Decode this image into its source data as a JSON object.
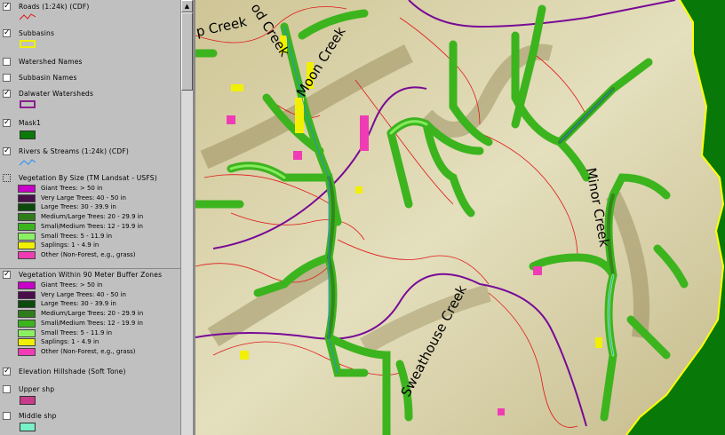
{
  "legend": {
    "layers": [
      {
        "label": "Roads (1:24k) (CDF)",
        "checked": true
      },
      {
        "label": "Subbasins",
        "checked": true
      },
      {
        "label": "Watershed Names",
        "checked": false
      },
      {
        "label": "Subbasin Names",
        "checked": false
      },
      {
        "label": "Dalwater Watersheds",
        "checked": true
      },
      {
        "label": "Mask1",
        "checked": true
      },
      {
        "label": "Rivers & Streams (1:24k) (CDF)",
        "checked": true
      },
      {
        "label": "Vegetation By Size (TM Landsat - USFS)",
        "checked": false
      },
      {
        "label": "Vegetation Within 90 Meter Buffer Zones",
        "checked": true
      },
      {
        "label": "Elevation Hillshade (Soft Tone)",
        "checked": true
      },
      {
        "label": "Upper shp",
        "checked": false
      },
      {
        "label": "Middle shp",
        "checked": false
      }
    ],
    "veg_classes": [
      {
        "label": "Giant Trees: > 50 in",
        "color": "#c800c8"
      },
      {
        "label": "Very Large Trees: 40 - 50 in",
        "color": "#4a0f4a"
      },
      {
        "label": "Large Trees: 30 - 39.9 in",
        "color": "#0b4a0b"
      },
      {
        "label": "Medium/Large Trees: 20 - 29.9 in",
        "color": "#2f7d1a"
      },
      {
        "label": "Small/Medium Trees: 12 - 19.9 in",
        "color": "#3cb41e"
      },
      {
        "label": "Small Trees: 5 - 11.9 in",
        "color": "#8cf064"
      },
      {
        "label": "Saplings: 1 - 4.9 in",
        "color": "#f0f000"
      },
      {
        "label": "Other (Non-Forest, e.g., grass)",
        "color": "#f03cb4"
      }
    ],
    "veg_classes_buffer": [
      {
        "label": "Giant Trees: > 50 in",
        "color": "#c800c8"
      },
      {
        "label": "Very Large Trees: 40 - 50 in",
        "color": "#4a0f4a"
      },
      {
        "label": "Large Trees: 30 - 39.9 in",
        "color": "#0b4a0b"
      },
      {
        "label": "Medium/Large Trees: 20 - 29.9 in",
        "color": "#2f7d1a"
      },
      {
        "label": "Small/Medium Trees: 12 - 19.9 in",
        "color": "#3cb41e"
      },
      {
        "label": "Small Trees: 5 - 11.9 in",
        "color": "#8cf064"
      },
      {
        "label": "Saplings: 1 - 4.9 in",
        "color": "#f0f000"
      },
      {
        "label": "Other (Non-Forest, e.g., grass)",
        "color": "#f03cb4"
      }
    ],
    "mask_color": "#0a7a0a",
    "upper_color": "#c83c8c",
    "middle_color": "#78f0c8",
    "watershed_color": "#8c1e8c",
    "subbasin_color": "#f0f000"
  },
  "map": {
    "labels": {
      "creek_1": "p Creek",
      "creek_2": "od Creek",
      "creek_3": "Moon Creek",
      "creek_4": "Minor Creek",
      "creek_5": "Sweathouse Creek"
    },
    "colors": {
      "mask": "#087808",
      "terrain": "#dcd6ac",
      "road": "#e01818",
      "stream": "#1f8cff",
      "watershed": "#780a96",
      "subbasin": "#ffff00"
    }
  },
  "scrollbar": {
    "up_glyph": "▲"
  }
}
